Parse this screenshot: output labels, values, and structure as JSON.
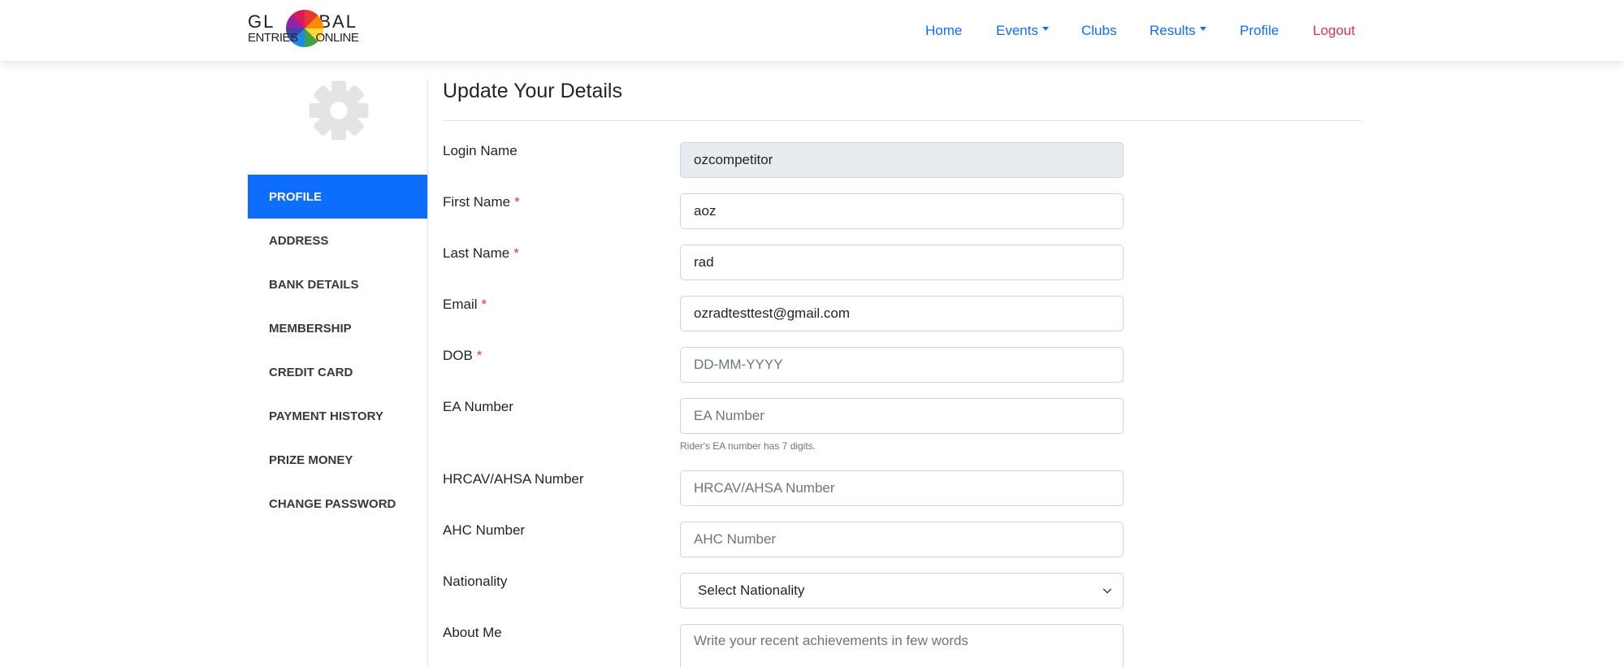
{
  "brand": {
    "line1_left": "GL",
    "line1_right": "BAL",
    "line2_left": "ENTRIES",
    "line2_right": "ONLINE",
    "logo_icon": "globe-logo"
  },
  "nav": {
    "home": "Home",
    "events": "Events",
    "clubs": "Clubs",
    "results": "Results",
    "profile": "Profile",
    "logout": "Logout"
  },
  "sidebar": {
    "icon": "gear-icon",
    "items": [
      {
        "label": "PROFILE",
        "active": true
      },
      {
        "label": "ADDRESS"
      },
      {
        "label": "BANK DETAILS"
      },
      {
        "label": "MEMBERSHIP"
      },
      {
        "label": "CREDIT CARD"
      },
      {
        "label": "PAYMENT HISTORY"
      },
      {
        "label": "PRIZE MONEY"
      },
      {
        "label": "CHANGE PASSWORD"
      }
    ]
  },
  "main": {
    "title": "Update Your Details",
    "required_marker": "*",
    "fields": {
      "login_name": {
        "label": "Login Name",
        "value": "ozcompetitor"
      },
      "first_name": {
        "label": "First Name",
        "value": "aoz"
      },
      "last_name": {
        "label": "Last Name",
        "value": "rad"
      },
      "email": {
        "label": "Email",
        "value": "ozradtesttest@gmail.com"
      },
      "dob": {
        "label": "DOB",
        "value": "",
        "placeholder": "DD-MM-YYYY"
      },
      "ea_number": {
        "label": "EA Number",
        "value": "",
        "placeholder": "EA Number",
        "help": "Rider's EA number has 7 digits."
      },
      "hrcav_number": {
        "label": "HRCAV/AHSA Number",
        "value": "",
        "placeholder": "HRCAV/AHSA Number"
      },
      "ahc_number": {
        "label": "AHC Number",
        "value": "",
        "placeholder": "AHC Number"
      },
      "nationality": {
        "label": "Nationality",
        "selected": "Select Nationality"
      },
      "about_me": {
        "label": "About Me",
        "value": "",
        "placeholder": "Write your recent achievements in few words"
      }
    }
  },
  "colors": {
    "primary": "#0d6efd",
    "danger": "#dc3545",
    "readonly_bg": "#e9ecef",
    "border": "#ced4da",
    "icon_grey": "#e3e4e6"
  }
}
